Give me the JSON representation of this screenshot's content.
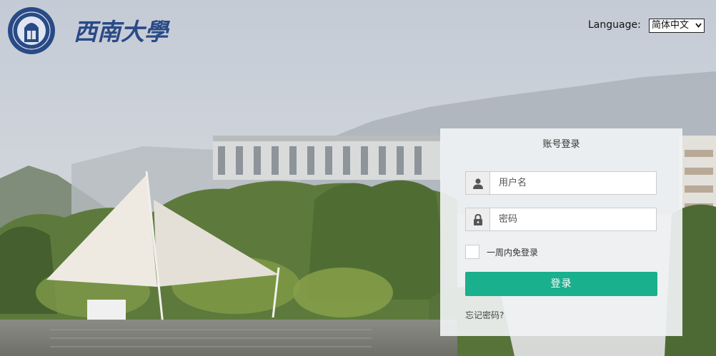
{
  "header": {
    "language_label": "Language:",
    "language_selected": "简体中文",
    "school_name": "西南大學"
  },
  "login": {
    "title": "账号登录",
    "username_placeholder": "用户名",
    "password_placeholder": "密码",
    "remember_label": "一周内免登录",
    "remember_checked": false,
    "submit_label": "登录",
    "forgot_link": "忘记密码?"
  },
  "icons": {
    "user_field": "user-icon",
    "password_field": "lock-icon",
    "language_caret": "chevron-down-icon"
  },
  "colors": {
    "submit_button": "#1aaf8d",
    "brand_blue": "#2a4a86"
  }
}
